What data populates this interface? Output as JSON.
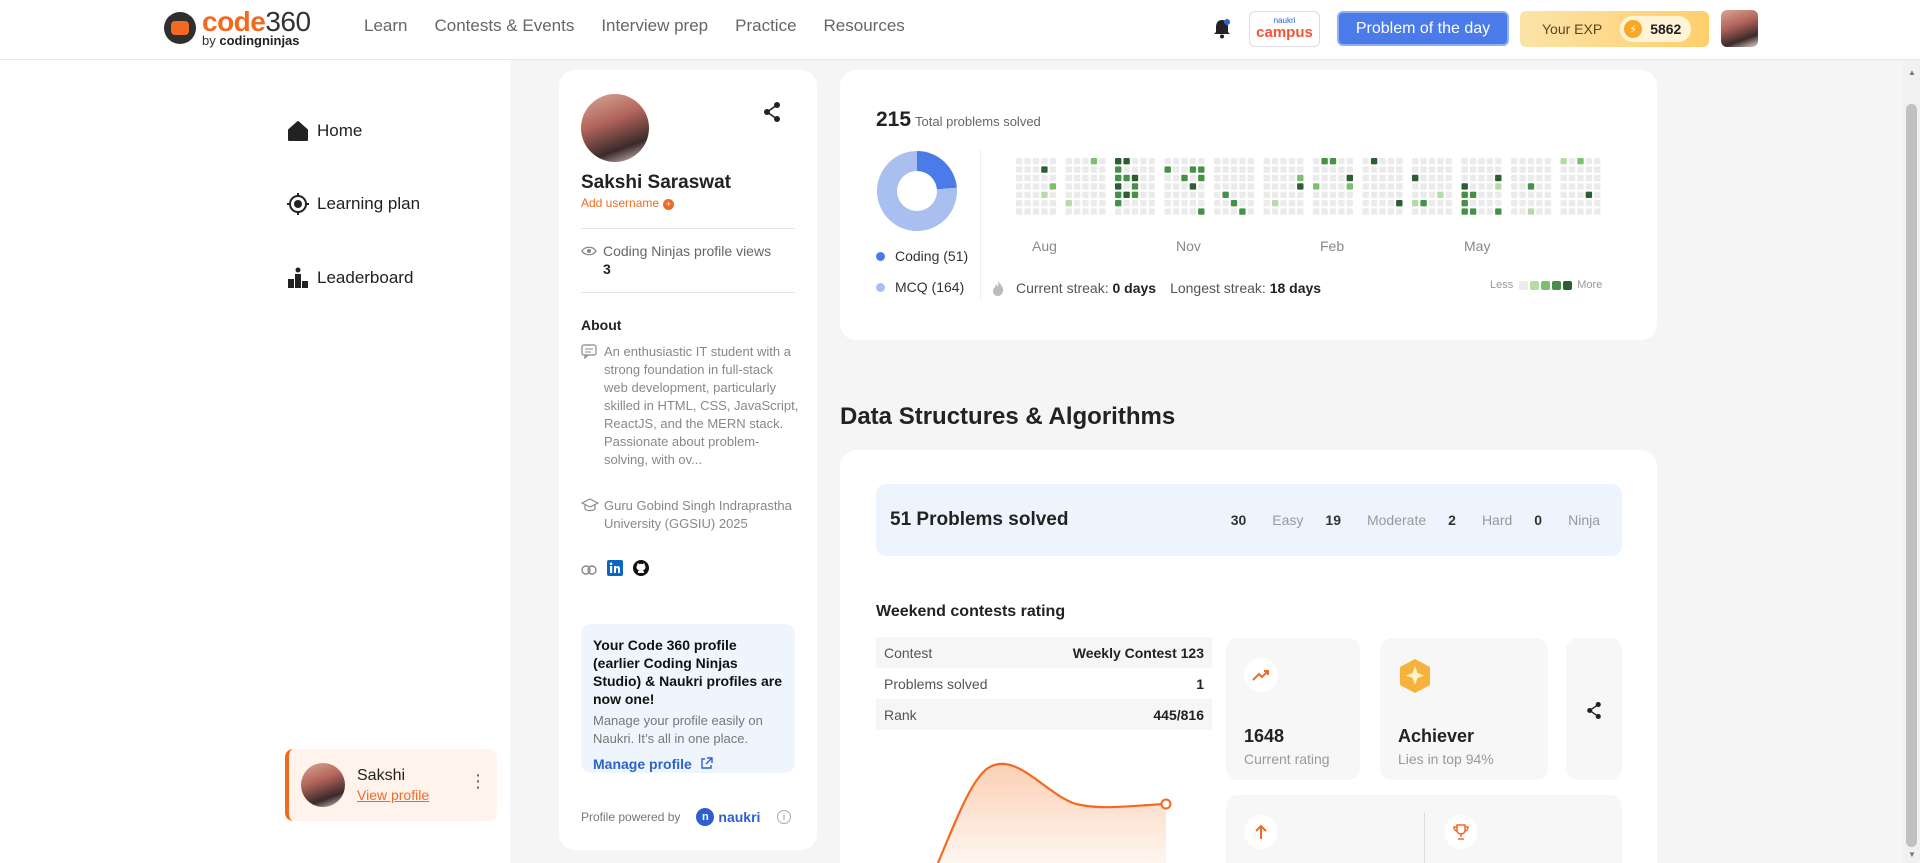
{
  "brand": {
    "name_orange": "code",
    "name_dark": "360",
    "sub_prefix": "by ",
    "sub_brand": "codingninjas"
  },
  "nav": [
    "Learn",
    "Contests & Events",
    "Interview prep",
    "Practice",
    "Resources"
  ],
  "header": {
    "campus_small": "naukri",
    "campus": "campus",
    "potd": "Problem of the day",
    "exp_label": "Your EXP",
    "exp_value": "5862"
  },
  "sidebar": {
    "items": [
      {
        "label": "Home",
        "icon": "home-icon"
      },
      {
        "label": "Learning plan",
        "icon": "target-icon"
      },
      {
        "label": "Leaderboard",
        "icon": "podium-icon"
      }
    ],
    "user": {
      "name": "Sakshi",
      "link": "View profile"
    }
  },
  "profile": {
    "name": "Sakshi Saraswat",
    "add_username": "Add username",
    "views_label": "Coding Ninjas profile views",
    "views": "3",
    "about_title": "About",
    "about": "An enthusiastic IT student with a strong foundation in full-stack web development, particularly skilled in HTML, CSS, JavaScript, ReactJS, and the MERN stack. Passionate about problem-solving, with ov...",
    "university": "Guru Gobind Singh Indraprastha University (GGSIU) 2025",
    "notice_title": "Your Code 360 profile (earlier Coding Ninjas Studio) & Naukri profiles are now one!",
    "notice_text": "Manage your profile easily on Naukri. It’s all in one place.",
    "manage": "Manage profile",
    "powered": "Profile powered by",
    "powered_brand": "naukri"
  },
  "solved": {
    "total": "215",
    "total_label": "Total problems solved",
    "coding_legend": "Coding (51)",
    "mcq_legend": "MCQ (164)",
    "months": [
      "Aug",
      "Nov",
      "Feb",
      "May"
    ],
    "current_label": "Current streak:",
    "current": "0 days",
    "longest_label": "Longest streak:",
    "longest": "18 days",
    "less": "Less",
    "more": "More",
    "colors": {
      "coding": "#4a7be8",
      "mcq": "#a9bff0",
      "empty": "#ebebeb",
      "l1": "#b5dca8",
      "l2": "#7cc06d",
      "l3": "#46914a",
      "l4": "#2b5e32"
    }
  },
  "chart_data": {
    "type": "pie",
    "categories": [
      "Coding",
      "MCQ"
    ],
    "values": [
      51,
      164
    ]
  },
  "dsa": {
    "title": "Data Structures & Algorithms",
    "problems": "51 Problems solved",
    "easy_n": "30",
    "easy": "Easy",
    "mod_n": "19",
    "mod": "Moderate",
    "hard_n": "2",
    "hard": "Hard",
    "ninja_n": "0",
    "ninja": "Ninja",
    "contest_title": "Weekend contests rating",
    "contest_rows": [
      {
        "label": "Contest",
        "value": "Weekly Contest 123"
      },
      {
        "label": "Problems solved",
        "value": "1"
      },
      {
        "label": "Rank",
        "value": "445/816"
      }
    ],
    "rating": "1648",
    "rating_label": "Current rating",
    "level": "Achiever",
    "level_label": "Lies in top 94%"
  }
}
